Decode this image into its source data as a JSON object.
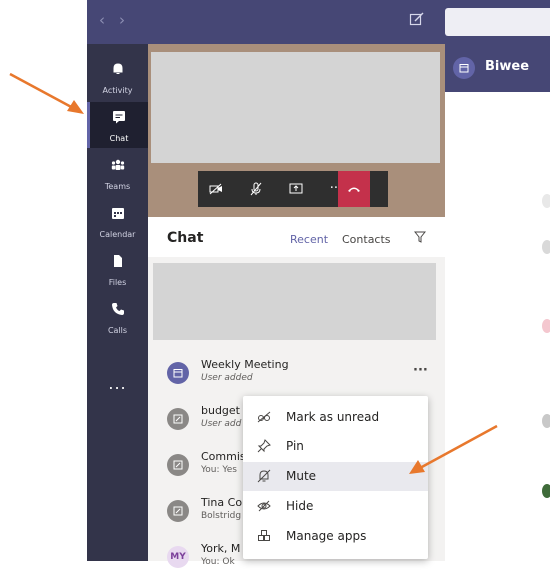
{
  "topbar": {
    "back_icon": "chevron-left-icon",
    "forward_icon": "chevron-right-icon",
    "compose_icon": "compose-icon"
  },
  "rail": {
    "items": [
      {
        "label": "Activity",
        "icon": "bell-icon"
      },
      {
        "label": "Chat",
        "icon": "chat-icon",
        "active": true
      },
      {
        "label": "Teams",
        "icon": "teams-icon"
      },
      {
        "label": "Calendar",
        "icon": "calendar-icon"
      },
      {
        "label": "Files",
        "icon": "file-icon"
      },
      {
        "label": "Calls",
        "icon": "phone-icon"
      }
    ],
    "more": "..."
  },
  "call_controls": {
    "more": "···"
  },
  "chat": {
    "title": "Chat",
    "tabs": {
      "recent": "Recent",
      "contacts": "Contacts"
    },
    "conversations": [
      {
        "name": "Weekly Meeting",
        "sub": "User added",
        "more": "···"
      },
      {
        "name": "budget",
        "sub": "User add"
      },
      {
        "name": "Commis",
        "sub": "You: Yes"
      },
      {
        "name": "Tina Co",
        "sub": "Bolstridg"
      },
      {
        "name": "York, M",
        "sub": "You: Ok",
        "avatar": "MY"
      }
    ]
  },
  "context_menu": {
    "items": [
      {
        "label": "Mark as unread",
        "icon": "glasses-icon"
      },
      {
        "label": "Pin",
        "icon": "pin-icon"
      },
      {
        "label": "Mute",
        "icon": "mute-bell-icon"
      },
      {
        "label": "Hide",
        "icon": "hide-eye-icon"
      },
      {
        "label": "Manage apps",
        "icon": "apps-icon"
      }
    ]
  },
  "meeting": {
    "title": "Biwee"
  },
  "colors": {
    "brand": "#464775",
    "rail": "#33344a",
    "accent": "#6264a7",
    "hangup": "#c4314b",
    "annotation": "#e8782d"
  }
}
